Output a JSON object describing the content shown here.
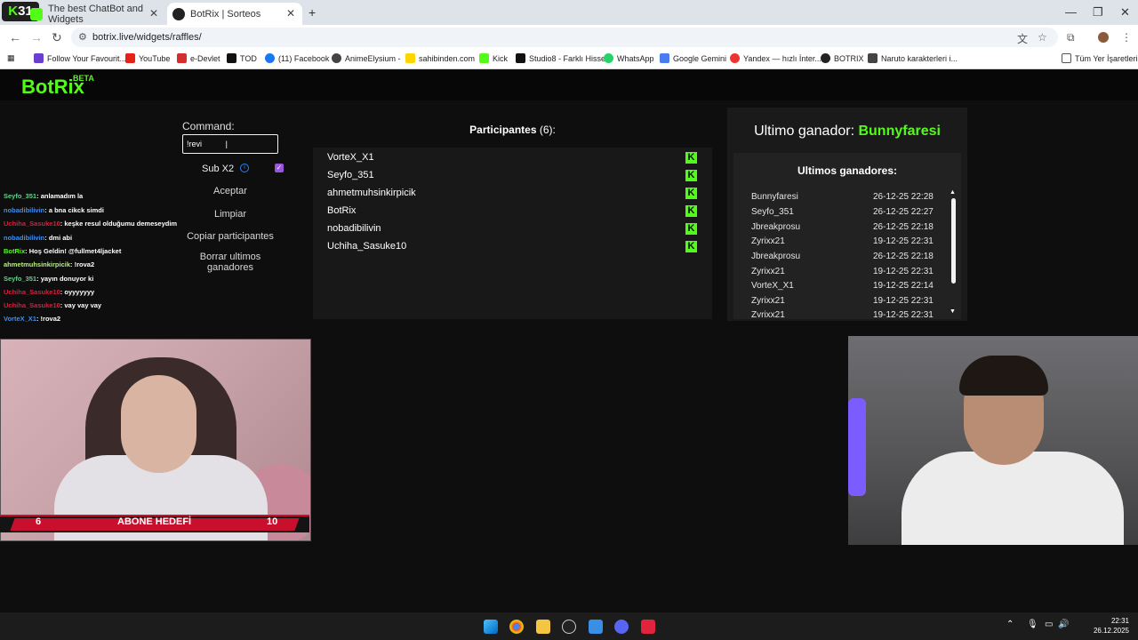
{
  "browser": {
    "tabs": [
      {
        "title": "The best ChatBot and Widgets",
        "active": false
      },
      {
        "title": "BotRix | Sorteos",
        "active": true
      }
    ],
    "new_tab": "+",
    "url": "botrix.live/widgets/raffles/",
    "window_controls": [
      "—",
      "❐",
      "✕"
    ],
    "bookmarks": [
      "Follow Your Favourit...",
      "YouTube",
      "e-Devlet",
      "TOD",
      "(11) Facebook",
      "AnimeElysium -",
      "sahibinden.com",
      "Kick",
      "Studio8 - Farklı Hisset",
      "WhatsApp",
      "Google Gemini",
      "Yandex — hızlı İnter...",
      "BOTRIX",
      "Naruto karakterleri i..."
    ],
    "all_bookmarks": "Tüm Yer İşaretleri"
  },
  "app": {
    "logo": "BotRix",
    "beta": "BETA",
    "command_label": "Command:",
    "command_value": "!revi",
    "sub_label": "Sub X2",
    "sub_checked": true,
    "buttons": {
      "accept": "Aceptar",
      "clear": "Limpiar",
      "copy": "Copiar participantes",
      "clear_winners": "Borrar ultimos ganadores"
    },
    "participants_title": "Participantes",
    "participants_count": "(6):",
    "participants": [
      "VorteX_X1",
      "Seyfo_351",
      "ahmetmuhsinkirpicik",
      "BotRix",
      "nobadibilivin",
      "Uchiha_Sasuke10"
    ],
    "platform_badge": "K",
    "last_winner_label": "Ultimo ganador:",
    "last_winner": "Bunnyfaresi",
    "recent_winners_title": "Ultimos ganadores:",
    "recent_winners": [
      {
        "name": "Bunnyfaresi",
        "date": "26-12-25 22:28"
      },
      {
        "name": "Seyfo_351",
        "date": "26-12-25 22:27"
      },
      {
        "name": "Jbreakprosu",
        "date": "26-12-25 22:18"
      },
      {
        "name": "Zyrixx21",
        "date": "19-12-25 22:31"
      },
      {
        "name": "Jbreakprosu",
        "date": "26-12-25 22:18"
      },
      {
        "name": "Zyrixx21",
        "date": "19-12-25 22:31"
      },
      {
        "name": "VorteX_X1",
        "date": "19-12-25 22:14"
      },
      {
        "name": "Zyrixx21",
        "date": "19-12-25 22:31"
      },
      {
        "name": "Zyrixx21",
        "date": "19-12-25 22:31"
      }
    ]
  },
  "chat": [
    {
      "user": "Seyfo_351",
      "color": "#5fd38d",
      "msg": ": anlamadım la"
    },
    {
      "user": "nobadibilivin",
      "color": "#3f8ef0",
      "msg": ": a bna cikck simdi"
    },
    {
      "user": "Uchiha_Sasuke10",
      "color": "#d0213f",
      "msg": ": keşke resul olduğumu demeseydim"
    },
    {
      "user": "nobadibilivin",
      "color": "#3f8ef0",
      "msg": ": dmi abi"
    },
    {
      "user": "BotRix",
      "color": "#53fc18",
      "msg": ": Hoş Geldin! @fullmet4ljacket"
    },
    {
      "user": "ahmetmuhsinkirpicik",
      "color": "#b6f07a",
      "msg": ": !rova2"
    },
    {
      "user": "Seyfo_351",
      "color": "#5fd38d",
      "msg": ": yayın donuyor ki"
    },
    {
      "user": "Uchiha_Sasuke10",
      "color": "#d0213f",
      "msg": ": oyyyyyyy"
    },
    {
      "user": "Uchiha_Sasuke10",
      "color": "#d0213f",
      "msg": ": vay vay vay"
    },
    {
      "user": "VorteX_X1",
      "color": "#3f8ef0",
      "msg": ": !rova2"
    }
  ],
  "goal": {
    "current": "6",
    "label": "ABONE HEDEFİ",
    "target": "10"
  },
  "taskbar": {
    "time": "22:31",
    "date": "26.12.2025"
  }
}
